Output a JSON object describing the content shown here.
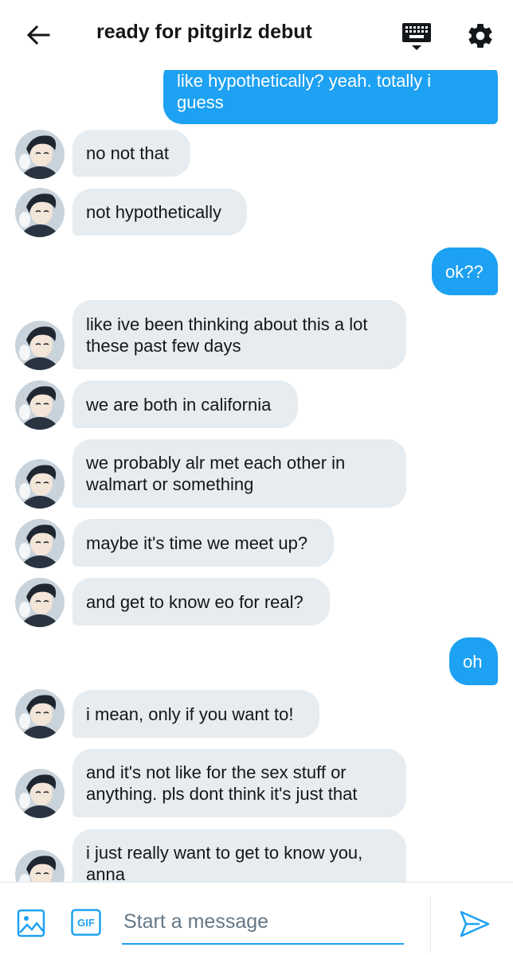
{
  "header": {
    "title": "ready for pitgirlz debut",
    "back_icon": "arrow-left-icon",
    "keyboard_icon": "keyboard-icon",
    "settings_icon": "gear-icon"
  },
  "messages": [
    {
      "from": "me",
      "lines": [
        "like hypothetically? yeah. totally i",
        "guess"
      ]
    },
    {
      "from": "them",
      "lines": [
        "no not that"
      ]
    },
    {
      "from": "them",
      "lines": [
        "not hypothetically"
      ]
    },
    {
      "from": "me",
      "lines": [
        "ok??"
      ]
    },
    {
      "from": "them",
      "lines": [
        "like ive been thinking about this a lot",
        "these past few days"
      ]
    },
    {
      "from": "them",
      "lines": [
        "we are both in california"
      ]
    },
    {
      "from": "them",
      "lines": [
        "we probably alr met each other in",
        "walmart or something"
      ]
    },
    {
      "from": "them",
      "lines": [
        "maybe it's time we meet up?"
      ]
    },
    {
      "from": "them",
      "lines": [
        "and get to know eo for real?"
      ]
    },
    {
      "from": "me",
      "lines": [
        "oh"
      ]
    },
    {
      "from": "them",
      "lines": [
        "i mean, only if you want to!"
      ]
    },
    {
      "from": "them",
      "lines": [
        "and it's not like for the sex stuff or",
        "anything. pls dont think it's just that"
      ]
    },
    {
      "from": "them",
      "lines": [
        "i just really want to get to know you,",
        "anna"
      ]
    }
  ],
  "composer": {
    "placeholder": "Start a message",
    "gif_label": "GIF",
    "media_icon": "image-icon",
    "send_icon": "send-icon"
  },
  "colors": {
    "accent": "#1da1f2",
    "incoming_bubble": "#e6ecf0",
    "text": "#14171a"
  }
}
